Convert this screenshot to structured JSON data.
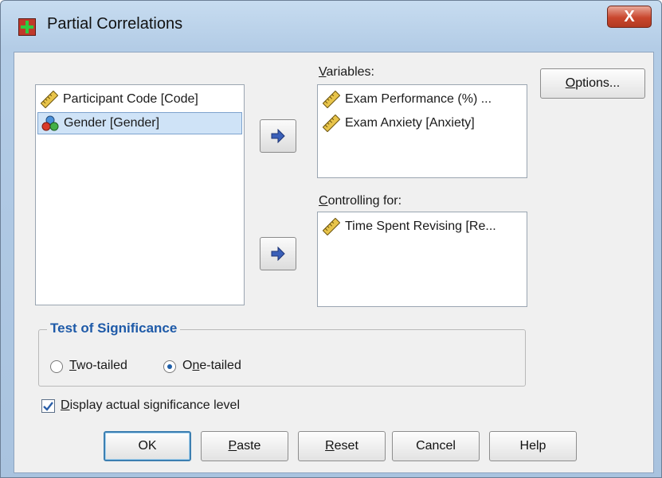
{
  "window": {
    "title": "Partial Correlations",
    "close_label": "X"
  },
  "source_list": {
    "items": [
      {
        "label": "Participant Code [Code]",
        "icon": "scale-ruler-icon",
        "selected": false
      },
      {
        "label": "Gender [Gender]",
        "icon": "nominal-icon",
        "selected": true
      }
    ]
  },
  "variables": {
    "label_u": "V",
    "label_rest": "ariables:",
    "items": [
      {
        "label": "Exam Performance (%) ...",
        "icon": "scale-ruler-icon"
      },
      {
        "label": "Exam Anxiety [Anxiety]",
        "icon": "scale-ruler-icon"
      }
    ]
  },
  "controlling": {
    "label_u": "C",
    "label_rest": "ontrolling for:",
    "items": [
      {
        "label": "Time Spent Revising [Re...",
        "icon": "scale-ruler-icon"
      }
    ]
  },
  "options_button": {
    "u": "O",
    "rest": "ptions..."
  },
  "significance": {
    "title": "Test of Significance",
    "two_tailed": {
      "u": "T",
      "rest": "wo-tailed",
      "checked": false
    },
    "one_tailed": {
      "pre": "O",
      "u": "n",
      "rest": "e-tailed",
      "checked": true
    }
  },
  "display_actual": {
    "u": "D",
    "rest": "isplay actual significance level",
    "checked": true
  },
  "buttons": {
    "ok": "OK",
    "paste": {
      "u": "P",
      "rest": "aste"
    },
    "reset": {
      "u": "R",
      "rest": "eset"
    },
    "cancel": "Cancel",
    "help": "Help"
  },
  "colors": {
    "accent": "#1e5aa8",
    "title_bar": "#b3cce6",
    "close": "#c9462d"
  }
}
